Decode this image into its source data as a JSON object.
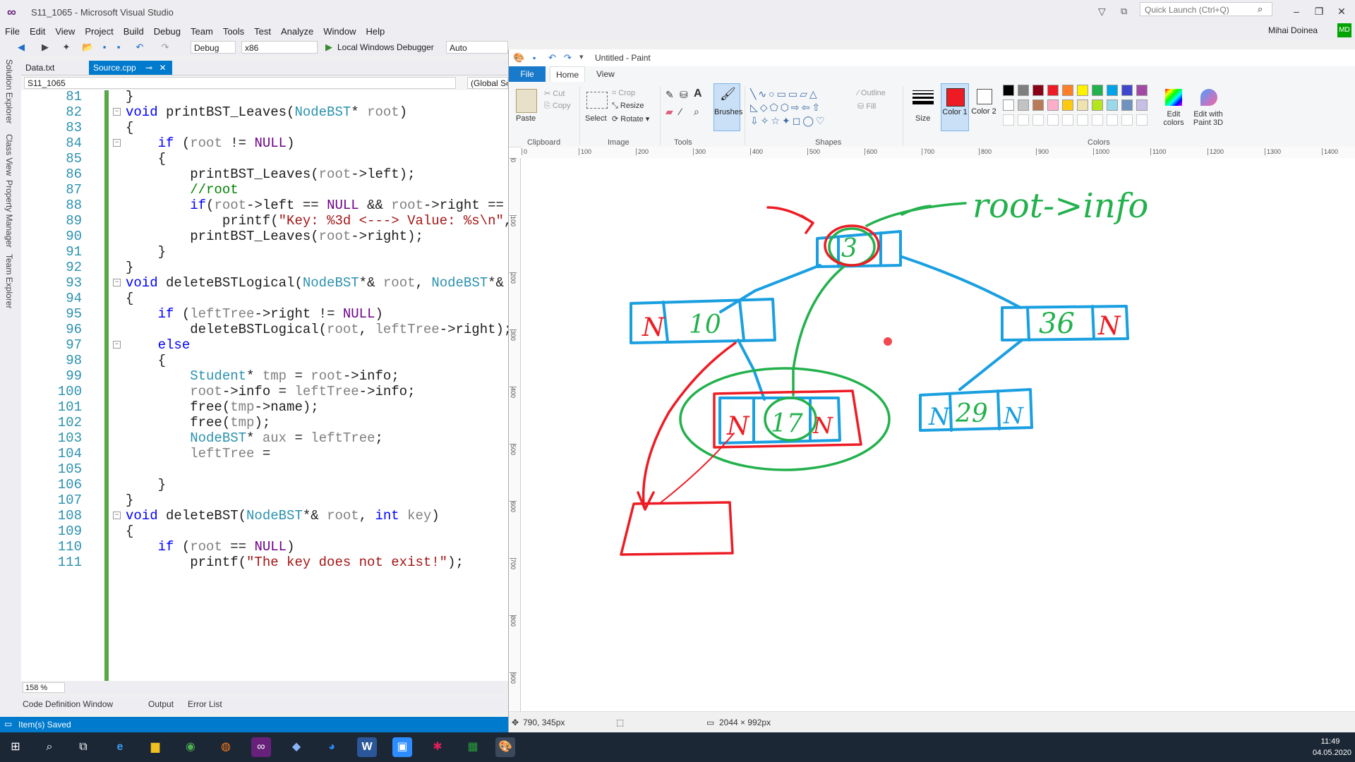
{
  "vs": {
    "title": "S11_1065 - Microsoft Visual Studio",
    "quick_launch": "Quick Launch (Ctrl+Q)",
    "user": "Mihai Doinea",
    "avatar": "MD",
    "menu": [
      "File",
      "Edit",
      "View",
      "Project",
      "Build",
      "Debug",
      "Team",
      "Tools",
      "Test",
      "Analyze",
      "Window",
      "Help"
    ],
    "toolbar": {
      "config": "Debug",
      "platform": "x86",
      "debugger": "Local Windows Debugger",
      "auto": "Auto"
    },
    "side_tabs": [
      "Solution Explorer",
      "Class View",
      "Property Manager",
      "Team Explorer"
    ],
    "tabs": {
      "data": "Data.txt",
      "source": "Source.cpp"
    },
    "nav": {
      "project": "S11_1065",
      "scope": "(Global Scope)"
    },
    "zoom": "158 %",
    "bottom_tabs": [
      "Code Definition Window",
      "Output",
      "Error List"
    ],
    "status": "Item(s) Saved"
  },
  "code_lines": [
    {
      "n": "81",
      "t": "}"
    },
    {
      "n": "82",
      "t": "void printBST_Leaves(NodeBST* root)"
    },
    {
      "n": "83",
      "t": "{"
    },
    {
      "n": "84",
      "t": "    if (root != NULL)"
    },
    {
      "n": "85",
      "t": "    {"
    },
    {
      "n": "86",
      "t": "        printBST_Leaves(root->left);"
    },
    {
      "n": "87",
      "t": "        //root"
    },
    {
      "n": "88",
      "t": "        if(root->left == NULL && root->right =="
    },
    {
      "n": "89",
      "t": "            printf(\"Key: %3d <---> Value: %s\\n\","
    },
    {
      "n": "90",
      "t": "        printBST_Leaves(root->right);"
    },
    {
      "n": "91",
      "t": "    }"
    },
    {
      "n": "92",
      "t": "}"
    },
    {
      "n": "93",
      "t": "void deleteBSTLogical(NodeBST*& root, NodeBST*&"
    },
    {
      "n": "94",
      "t": "{"
    },
    {
      "n": "95",
      "t": "    if (leftTree->right != NULL)"
    },
    {
      "n": "96",
      "t": "        deleteBSTLogical(root, leftTree->right);"
    },
    {
      "n": "97",
      "t": "    else"
    },
    {
      "n": "98",
      "t": "    {"
    },
    {
      "n": "99",
      "t": "        Student* tmp = root->info;"
    },
    {
      "n": "100",
      "t": "        root->info = leftTree->info;"
    },
    {
      "n": "101",
      "t": "        free(tmp->name);"
    },
    {
      "n": "102",
      "t": "        free(tmp);"
    },
    {
      "n": "103",
      "t": "        NodeBST* aux = leftTree;"
    },
    {
      "n": "104",
      "t": "        leftTree ="
    },
    {
      "n": "105",
      "t": ""
    },
    {
      "n": "106",
      "t": "    }"
    },
    {
      "n": "107",
      "t": "}"
    },
    {
      "n": "108",
      "t": "void deleteBST(NodeBST*& root, int key)"
    },
    {
      "n": "109",
      "t": "{"
    },
    {
      "n": "110",
      "t": "    if (root == NULL)"
    },
    {
      "n": "111",
      "t": "        printf(\"The key does not exist!\");"
    }
  ],
  "paint": {
    "title": "Untitled - Paint",
    "tabs": {
      "file": "File",
      "home": "Home",
      "view": "View"
    },
    "ribbon": {
      "paste": "Paste",
      "cut": "Cut",
      "copy": "Copy",
      "select": "Select",
      "crop": "Crop",
      "resize": "Resize",
      "rotate": "Rotate",
      "brushes": "Brushes",
      "outline": "Outline",
      "fill": "Fill",
      "size": "Size",
      "color1": "Color 1",
      "color2": "Color 2",
      "edit_colors": "Edit colors",
      "edit_3d": "Edit with Paint 3D",
      "groups": [
        "Clipboard",
        "Image",
        "Tools",
        "Shapes",
        "Colors"
      ]
    },
    "palette": [
      "#000000",
      "#7f7f7f",
      "#880015",
      "#ed1c24",
      "#ff7f27",
      "#fff200",
      "#22b14c",
      "#00a2e8",
      "#3f48cc",
      "#a349a4",
      "#ffffff",
      "#c3c3c3",
      "#b97a57",
      "#ffaec9",
      "#ffc90e",
      "#efe4b0",
      "#b5e61d",
      "#99d9ea",
      "#7092be",
      "#c8bfe7"
    ],
    "active_color": "#ed1c24",
    "ruler": [
      "0",
      "100",
      "200",
      "300",
      "400",
      "500",
      "600",
      "700",
      "800",
      "900",
      "1000",
      "1100",
      "1200",
      "1300",
      "1400"
    ],
    "status": {
      "cursor": "790, 345px",
      "canvas_size": "2044 × 992px"
    },
    "drawing": {
      "annotation": "root->info",
      "nodes": [
        {
          "label": "N"
        },
        {
          "label": "10"
        },
        {
          "label": "36"
        },
        {
          "label": "N"
        },
        {
          "label": "N"
        },
        {
          "label": "17"
        },
        {
          "label": "N"
        },
        {
          "label": "N"
        },
        {
          "label": "29"
        },
        {
          "label": "N"
        },
        {
          "label": "3"
        }
      ]
    }
  },
  "taskbar": {
    "time": "11:49",
    "date": "04.05.2020"
  }
}
